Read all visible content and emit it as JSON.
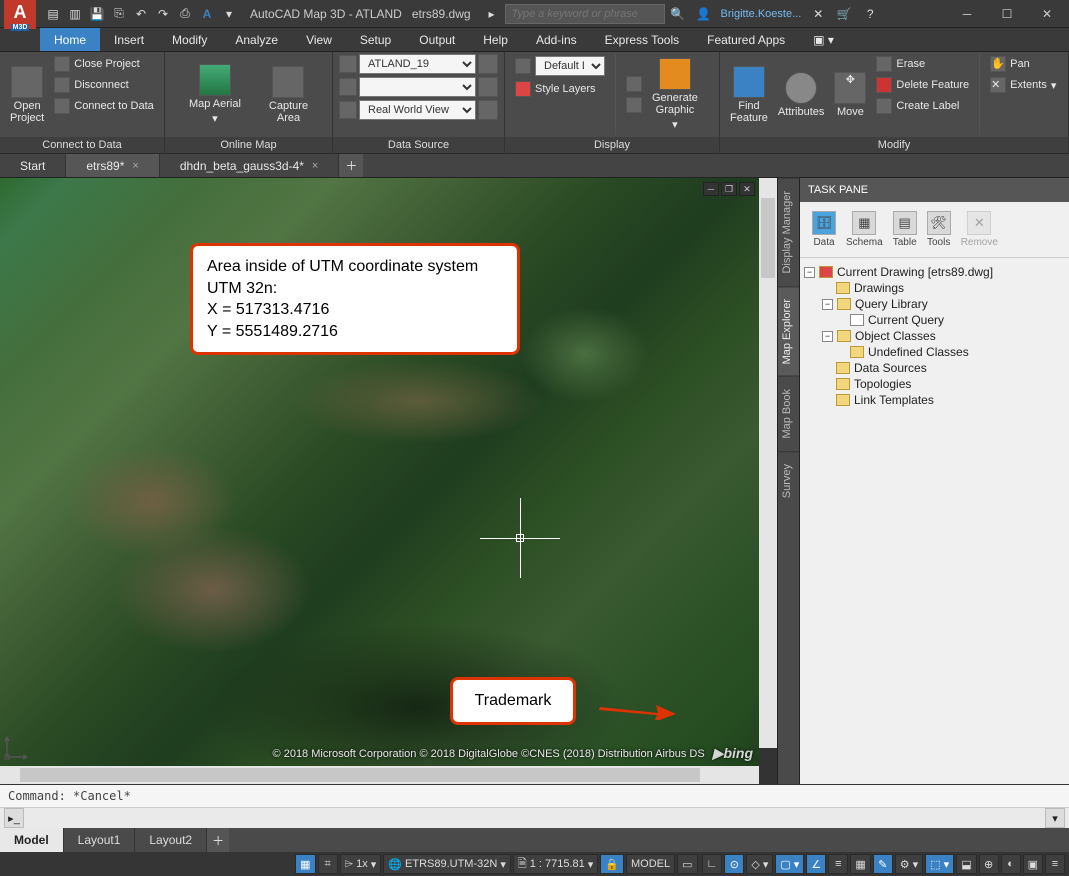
{
  "title": {
    "app": "AutoCAD Map 3D - ATLAND",
    "doc": "etrs89.dwg"
  },
  "search_placeholder": "Type a keyword or phrase",
  "username": "Brigitte.Koeste...",
  "menus": [
    "Home",
    "Insert",
    "Modify",
    "Analyze",
    "View",
    "Setup",
    "Output",
    "Help",
    "Add-ins",
    "Express Tools",
    "Featured Apps"
  ],
  "ribbon": {
    "connect": {
      "open": "Open\nProject",
      "close": "Close Project",
      "disconnect": "Disconnect",
      "connect": "Connect to Data",
      "title": "Connect to Data"
    },
    "online": {
      "aerial": "Map Aerial",
      "capture": "Capture\nArea",
      "title": "Online Map"
    },
    "datasource": {
      "row1": "ATLAND_19",
      "row3": "Real World View",
      "title": "Data Source"
    },
    "display": {
      "default": "Default D",
      "style": "Style Layers",
      "gen": "Generate\nGraphic",
      "title": "Display"
    },
    "modify": {
      "find": "Find\nFeature",
      "attr": "Attributes",
      "move": "Move",
      "erase": "Erase",
      "del": "Delete Feature",
      "label": "Create Label",
      "pan": "Pan",
      "extents": "Extents",
      "title": "Modify"
    }
  },
  "doctabs": [
    "Start",
    "etrs89*",
    "dhdn_beta_gauss3d-4*"
  ],
  "annotation1": {
    "l1": "Area inside of UTM coordinate system",
    "l2": "UTM 32n:",
    "l3": "X = 517313.4716",
    "l4": "Y = 5551489.2716"
  },
  "annotation2": "Trademark",
  "attribution": "© 2018 Microsoft Corporation © 2018 DigitalGlobe ©CNES (2018) Distribution Airbus DS",
  "bing": "bing",
  "sidetabs": [
    "Display Manager",
    "Map Explorer",
    "Map Book",
    "Survey"
  ],
  "taskpane": {
    "title": "TASK PANE",
    "tools": [
      "Data",
      "Schema",
      "Table",
      "Tools",
      "Remove"
    ],
    "tree": {
      "root": "Current Drawing [etrs89.dwg]",
      "n1": "Drawings",
      "n2": "Query Library",
      "n2a": "Current Query",
      "n3": "Object Classes",
      "n3a": "Undefined Classes",
      "n4": "Data Sources",
      "n5": "Topologies",
      "n6": "Link Templates"
    }
  },
  "cmd_hist": "Command: *Cancel*",
  "layouttabs": [
    "Model",
    "Layout1",
    "Layout2"
  ],
  "status": {
    "cs": "ETRS89.UTM-32N",
    "scale": "1 : 7715.81",
    "space": "MODEL",
    "onex": "1x"
  }
}
